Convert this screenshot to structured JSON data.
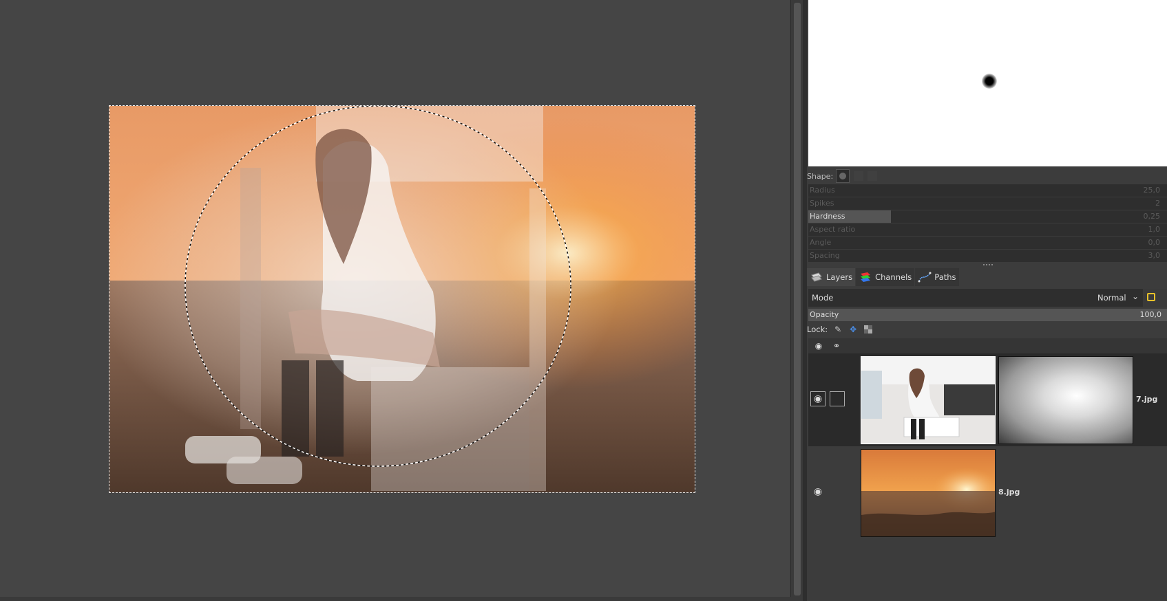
{
  "brush_options": {
    "shape_label": "Shape:",
    "sliders": [
      {
        "label": "Radius",
        "value": "25,0",
        "enabled": false
      },
      {
        "label": "Spikes",
        "value": "2",
        "enabled": false
      },
      {
        "label": "Hardness",
        "value": "0,25",
        "enabled": true,
        "fill_fraction": 0.23
      },
      {
        "label": "Aspect ratio",
        "value": "1,0",
        "enabled": false
      },
      {
        "label": "Angle",
        "value": "0,0",
        "enabled": false
      },
      {
        "label": "Spacing",
        "value": "3,0",
        "enabled": false
      }
    ]
  },
  "dock_tabs": [
    {
      "label": "Layers",
      "icon": "layers-icon",
      "active": true
    },
    {
      "label": "Channels",
      "icon": "channels-icon",
      "active": false
    },
    {
      "label": "Paths",
      "icon": "paths-icon",
      "active": false
    }
  ],
  "layers_panel": {
    "mode_label": "Mode",
    "mode_value": "Normal",
    "opacity_label": "Opacity",
    "opacity_value": "100,0",
    "lock_label": "Lock:",
    "layers": [
      {
        "name": "7.jpg",
        "visible": true,
        "selected": true,
        "has_mask": true
      },
      {
        "name": "8.jpg",
        "visible": true,
        "selected": false,
        "has_mask": false
      }
    ]
  },
  "colors": {
    "canvas_bg": "#454545",
    "panel_bg": "#3c3c3c",
    "selection_border": "#eeeeee",
    "lock_accent": "#e8c22a"
  }
}
